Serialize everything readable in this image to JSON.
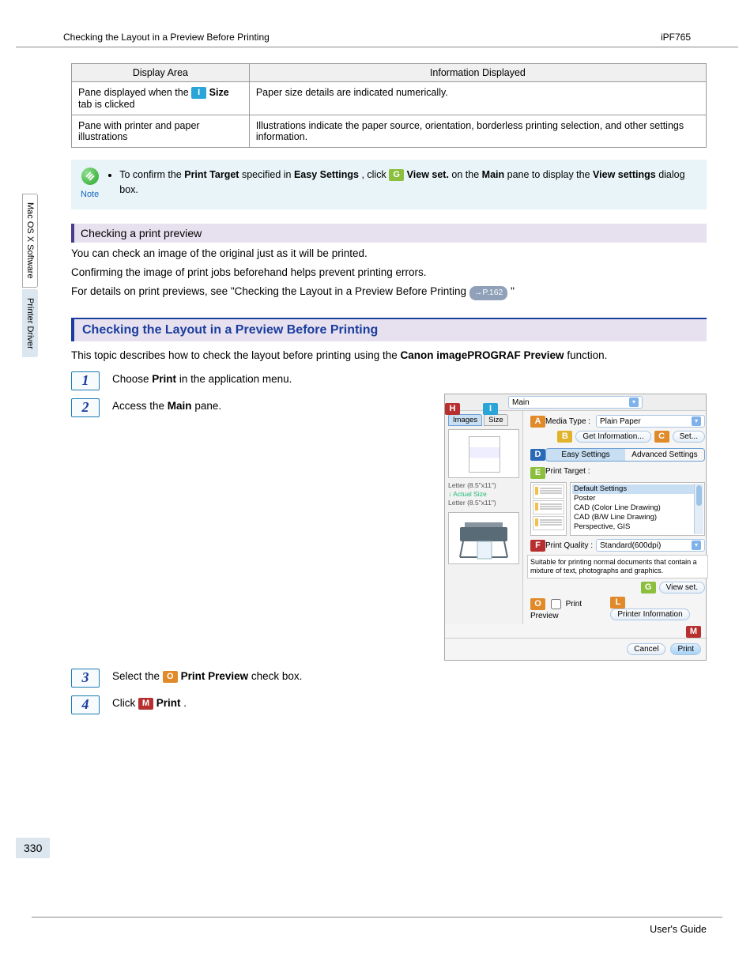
{
  "header": {
    "left": "Checking the Layout in a Preview Before Printing",
    "right": "iPF765"
  },
  "side_tabs": [
    "Mac OS X Software",
    "Printer Driver"
  ],
  "page_number": "330",
  "footer": "User's Guide",
  "table": {
    "h1": "Display Area",
    "h2": "Information Displayed",
    "r1c1_pre": "Pane displayed when the ",
    "r1c1_tab": "Size",
    "r1c1_post": " tab is clicked",
    "r1c2": "Paper size details are indicated numerically.",
    "r2c1": "Pane with printer and paper illustrations",
    "r2c2": "Illustrations indicate the paper source, orientation, borderless printing selection, and other settings information."
  },
  "note": {
    "label": "Note",
    "text_pre": "To confirm the ",
    "b1": "Print Target",
    "mid1": " specified in ",
    "b2": "Easy Settings",
    "mid2": ", click ",
    "b3": "View set.",
    "mid3": " on the ",
    "b4": "Main",
    "mid4": " pane to display the ",
    "b5": "View settings",
    "post": " dialog box."
  },
  "section1": "Checking a print preview",
  "body1": "You can check an image of the original just as it will be printed.",
  "body2": "Confirming the image of print jobs beforehand helps prevent printing errors.",
  "body3_pre": "For details on print previews, see \"Checking the Layout in a Preview Before Printing ",
  "body3_ref": "→P.162",
  "body3_post": " \"",
  "major": "Checking the Layout in a Preview Before Printing",
  "intro_pre": "This topic describes how to check the layout before printing using the ",
  "intro_bold": "Canon imagePROGRAF Preview",
  "intro_post": " function.",
  "steps": {
    "s1_pre": "Choose ",
    "s1_b": "Print",
    "s1_post": " in the application menu.",
    "s2_pre": "Access the ",
    "s2_b": "Main",
    "s2_post": " pane.",
    "s3_pre": "Select the ",
    "s3_b": "Print Preview",
    "s3_post": " check box.",
    "s4_pre": "Click ",
    "s4_b": "Print",
    "s4_post": "."
  },
  "letters": {
    "I": "I",
    "G": "G",
    "O": "O",
    "M": "M",
    "H": "H",
    "A": "A",
    "B": "B",
    "C": "C",
    "D": "D",
    "E": "E",
    "F": "F",
    "L": "L"
  },
  "dialog": {
    "tab_main": "Main",
    "tab_images": "Images",
    "tab_size": "Size",
    "media_type_lbl": "Media Type :",
    "media_type_val": "Plain Paper",
    "get_info": "Get Information...",
    "set": "Set...",
    "easy": "Easy Settings",
    "advanced": "Advanced Settings",
    "print_target_lbl": "Print Target :",
    "targets": [
      "Default Settings",
      "Poster",
      "CAD (Color Line Drawing)",
      "CAD (B/W Line Drawing)",
      "Perspective, GIS"
    ],
    "quality_lbl": "Print Quality :",
    "quality_val": "Standard(600dpi)",
    "desc": "Suitable for printing normal documents that contain a mixture of text, photographs and graphics.",
    "view_set": "View set.",
    "print_preview": "Print Preview",
    "printer_info": "Printer Information",
    "cancel": "Cancel",
    "print": "Print",
    "left_line1": "Letter (8.5\"x11\")",
    "left_arrow": "Actual Size",
    "left_line2": "Letter (8.5\"x11\")"
  },
  "colors": {
    "I": "#2aa5d8",
    "G": "#8bbf3d",
    "O": "#e08a2a",
    "M": "#b82f2f",
    "H": "#b82f2f",
    "A": "#e08a2a",
    "B": "#e0b32a",
    "C": "#e08a2a",
    "D": "#2a68b8",
    "E": "#8bbf3d",
    "F": "#b82f2f",
    "L": "#e08a2a"
  }
}
